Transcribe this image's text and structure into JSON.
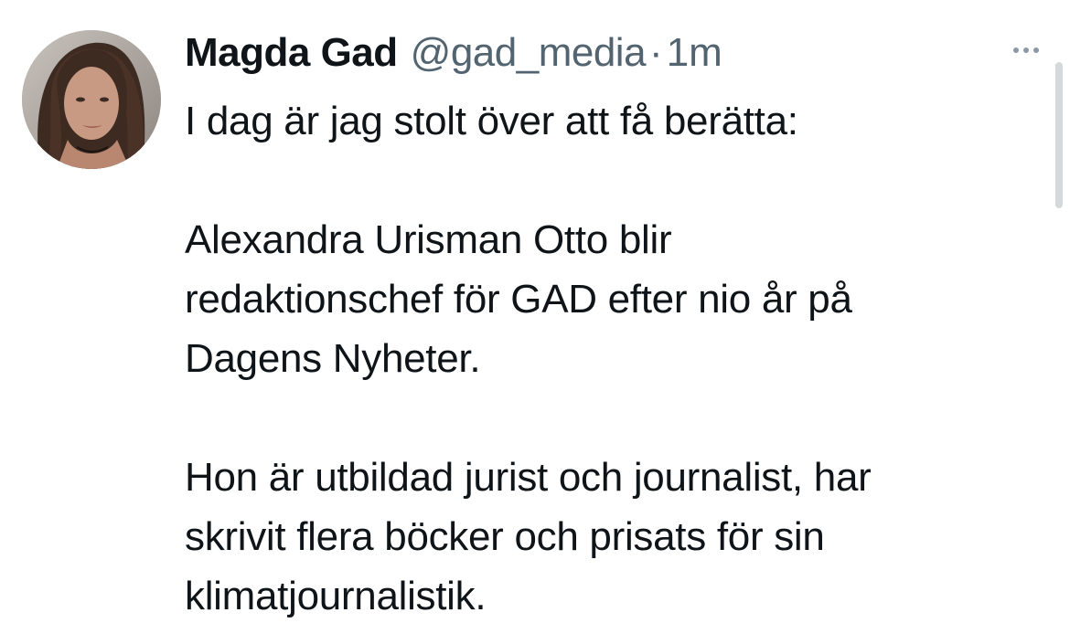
{
  "tweet": {
    "author_name": "Magda Gad",
    "author_handle": "@gad_media",
    "separator": "·",
    "time_ago": "1m",
    "more_icon": "ellipsis-icon",
    "avatar_icon": "avatar",
    "paragraphs": [
      {
        "lines": [
          "I dag är jag stolt över att få berätta:"
        ]
      },
      {
        "lines": [
          "Alexandra Urisman Otto blir",
          "redaktionschef för GAD efter nio år på",
          "Dagens Nyheter."
        ]
      },
      {
        "lines": [
          "Hon är utbildad jurist och journalist, har",
          "skrivit flera böcker och prisats för sin",
          "klimatjournalistik."
        ]
      }
    ]
  },
  "colors": {
    "text_primary": "#0f1419",
    "text_secondary": "#536471",
    "background": "#ffffff"
  }
}
